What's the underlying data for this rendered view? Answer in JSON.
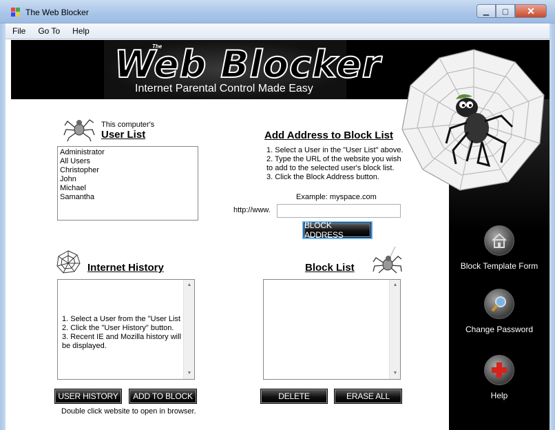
{
  "window": {
    "title": "The Web Blocker",
    "minimize": "▁",
    "maximize": "▢",
    "close": "✕"
  },
  "menu": {
    "items": [
      "File",
      "Go To",
      "Help"
    ]
  },
  "header": {
    "the": "The",
    "title": "Web Blocker",
    "tagline": "Internet Parental Control Made Easy"
  },
  "user_list": {
    "caption": "This computer's",
    "heading": "User List",
    "users": [
      "Administrator",
      "All Users",
      "Christopher",
      "John",
      "Michael",
      "Samantha"
    ]
  },
  "add_address": {
    "heading": "Add Address to Block List",
    "steps": [
      "1. Select a User in the \"User List\" above.",
      "2. Type the URL of the website you wish",
      "to add to the selected user's block list.",
      "3. Click the Block Address button."
    ],
    "example": "Example: myspace.com",
    "prefix": "http://www.",
    "url_value": "",
    "button": "BLOCK ADDRESS"
  },
  "history": {
    "heading": "Internet History",
    "lines": [
      "1. Select a User from the \"User List",
      "2. Click the \"User History\" button.",
      "3. Recent IE and Mozilla history will",
      "be displayed."
    ],
    "user_history_button": "USER HISTORY",
    "add_to_block_button": "ADD TO BLOCK",
    "hint": "Double click website to open in browser."
  },
  "block_list": {
    "heading": "Block List",
    "delete_button": "DELETE",
    "erase_all_button": "ERASE ALL"
  },
  "sidebar": {
    "template_label": "Block Template Form",
    "password_label": "Change Password",
    "help_label": "Help"
  },
  "colors": {
    "accent_red": "#d8221a",
    "dark": "#000000",
    "titlebar": "#a9c5e8"
  }
}
